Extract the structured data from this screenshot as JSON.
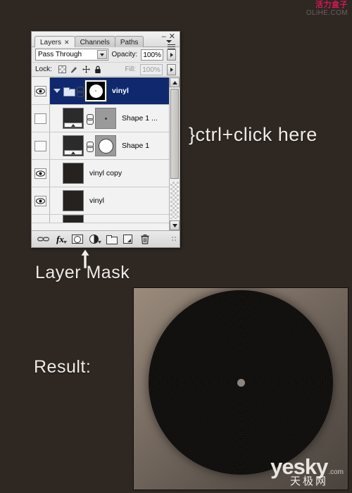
{
  "watermarks": {
    "top_right_cn": "活力盒子",
    "top_right_en": "OLiHE.COM",
    "result_brand": "yesky",
    "result_brand_suffix": ".com",
    "result_brand_cn": "天极网"
  },
  "panel": {
    "tabs": [
      {
        "label": "Layers",
        "active": true,
        "close": "✕"
      },
      {
        "label": "Channels",
        "active": false
      },
      {
        "label": "Paths",
        "active": false
      }
    ],
    "window_buttons": {
      "minimize": "–",
      "close": "✕"
    },
    "blend_mode": "Pass Through",
    "opacity_label": "Opacity:",
    "opacity_value": "100%",
    "lock_label": "Lock:",
    "lock_icons": [
      "lock-transparency-icon",
      "lock-pixels-icon",
      "lock-position-icon",
      "lock-all-icon"
    ],
    "fill_label": "Fill:",
    "fill_value": "100%",
    "layers": [
      {
        "name": "vinyl",
        "visible": true,
        "selected": true,
        "type": "group",
        "thumb": "layer-mask-circle"
      },
      {
        "name": "Shape 1 ...",
        "visible": false,
        "selected": false,
        "type": "shape",
        "thumb": "vinyl-gradient",
        "thumb2": "vector-mask-dot"
      },
      {
        "name": "Shape 1",
        "visible": false,
        "selected": false,
        "type": "shape",
        "thumb": "vinyl-gradient",
        "thumb2": "vector-mask-circle"
      },
      {
        "name": "vinyl copy",
        "visible": true,
        "selected": false,
        "type": "layer",
        "thumb": "dark-plain"
      },
      {
        "name": "vinyl",
        "visible": true,
        "selected": false,
        "type": "layer",
        "thumb": "dark-plain"
      }
    ],
    "toolbar_buttons": [
      {
        "name": "link-layers-icon",
        "glyph": "⚭"
      },
      {
        "name": "layer-style-fx-icon",
        "glyph": "fx"
      },
      {
        "name": "add-layer-mask-icon",
        "glyph": ""
      },
      {
        "name": "new-adjustment-layer-icon",
        "glyph": ""
      },
      {
        "name": "new-group-icon",
        "glyph": ""
      },
      {
        "name": "new-layer-icon",
        "glyph": ""
      },
      {
        "name": "delete-layer-icon",
        "glyph": "🗑"
      }
    ]
  },
  "annotations": {
    "ctrl_click": "}ctrl+click here",
    "layer_mask": "Layer Mask",
    "result": "Result:"
  }
}
